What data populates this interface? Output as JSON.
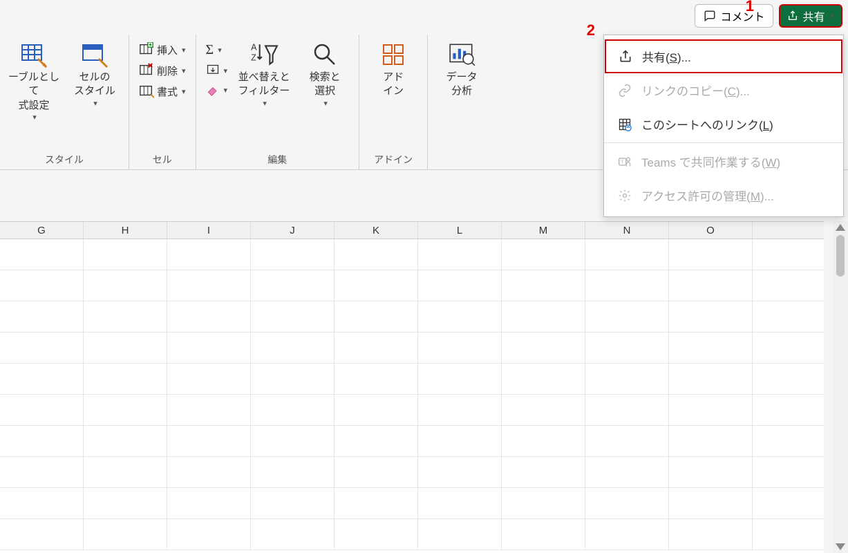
{
  "callouts": {
    "one": "1",
    "two": "2"
  },
  "topbar": {
    "comment_label": "コメント",
    "share_label": "共有"
  },
  "ribbon": {
    "styles": {
      "tableformat": "ーブルとして\n式設定",
      "cellstyles": "セルの\nスタイル",
      "group_label": "スタイル"
    },
    "cells": {
      "insert": "挿入",
      "delete": "削除",
      "format": "書式",
      "group_label": "セル"
    },
    "editing": {
      "sortfilter": "並べ替えと\nフィルター",
      "findselect": "検索と\n選択",
      "group_label": "編集"
    },
    "addins": {
      "addin": "アド\nイン",
      "group_label": "アドイン"
    },
    "analysis": {
      "data": "データ\n分析"
    }
  },
  "share_menu": {
    "share": "共有(",
    "share_key": "S",
    "share_suffix": ")...",
    "copylink": "リンクのコピー(",
    "copylink_key": "C",
    "copylink_suffix": ")...",
    "sheetlink": "このシートへのリンク(",
    "sheetlink_key": "L",
    "sheetlink_suffix": ")",
    "teams": "Teams で共同作業する(",
    "teams_key": "W",
    "teams_suffix": ")",
    "manage": "アクセス許可の管理(",
    "manage_key": "M",
    "manage_suffix": ")..."
  },
  "columns": [
    "G",
    "H",
    "I",
    "J",
    "K",
    "L",
    "M",
    "N",
    "O"
  ]
}
